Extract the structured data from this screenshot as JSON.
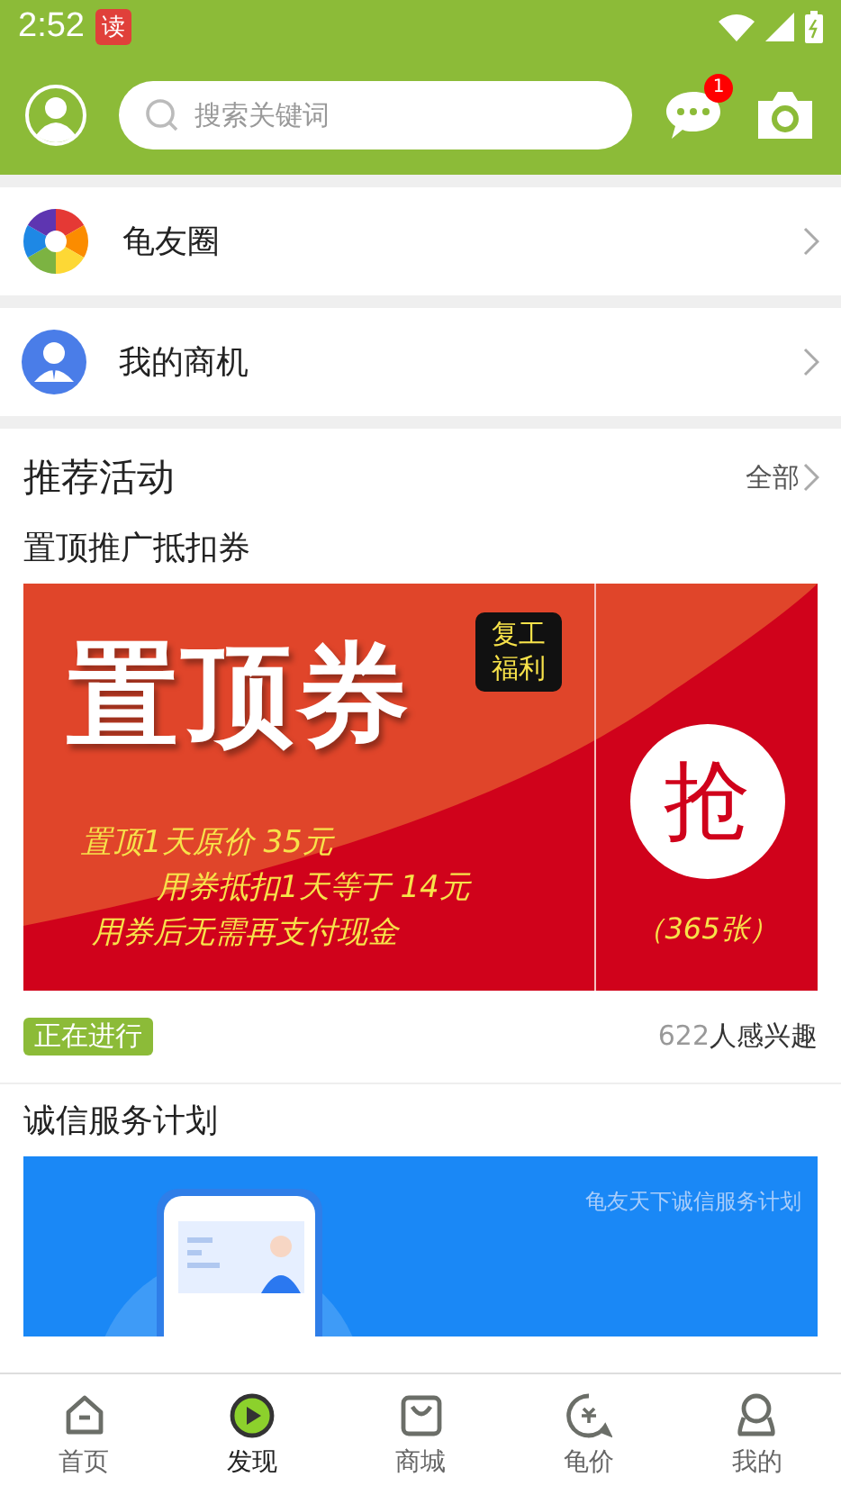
{
  "status_bar": {
    "time": "2:52",
    "app_badge": "读"
  },
  "header": {
    "search": {
      "placeholder": "搜索关键词"
    },
    "message_count": "1"
  },
  "menu_rows": [
    {
      "label": "龟友圈",
      "kind": "circle"
    },
    {
      "label": "我的商机",
      "kind": "business"
    }
  ],
  "recommended": {
    "title": "推荐活动",
    "all_link": "全部",
    "activities": [
      {
        "title": "置顶推广抵扣券",
        "banner": {
          "kind": "coupon",
          "headline": "置顶券",
          "tag": "复工福利",
          "lines": [
            "置顶1天原价 35元",
            "用券抵扣1天等于 14元",
            "用券后无需再支付现金"
          ],
          "grab": "抢",
          "count": "（365张）"
        },
        "status": "正在进行",
        "interest_count": "622",
        "interest_label": "人感兴趣"
      },
      {
        "title": "诚信服务计划",
        "banner": {
          "kind": "trust",
          "caption": "龟友天下诚信服务计划"
        }
      }
    ]
  },
  "tab_bar": [
    {
      "label": "首页",
      "kind": "home",
      "selected": false
    },
    {
      "label": "发现",
      "kind": "discover",
      "selected": true
    },
    {
      "label": "商城",
      "kind": "shop",
      "selected": false
    },
    {
      "label": "龟价",
      "kind": "price",
      "selected": false
    },
    {
      "label": "我的",
      "kind": "me",
      "selected": false
    }
  ]
}
